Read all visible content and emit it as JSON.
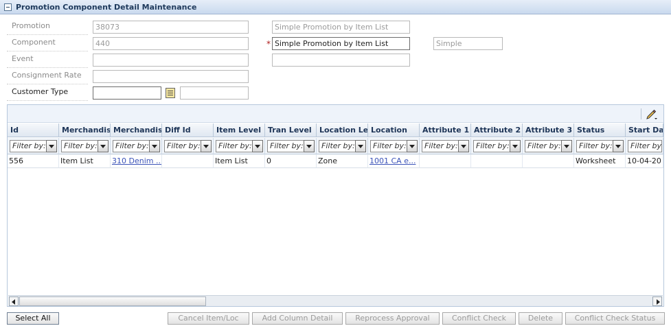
{
  "panel": {
    "title": "Promotion Component Detail Maintenance"
  },
  "form": {
    "promotion": {
      "label": "Promotion",
      "value": "38073",
      "description": "Simple Promotion by Item List"
    },
    "component": {
      "label": "Component",
      "value": "440",
      "name": "Simple Promotion by Item List",
      "type": "Simple"
    },
    "event": {
      "label": "Event",
      "value": "",
      "description": ""
    },
    "consignment_rate": {
      "label": "Consignment Rate",
      "value": ""
    },
    "customer_type": {
      "label": "Customer Type",
      "value": "",
      "description": ""
    }
  },
  "grid": {
    "columns": [
      "Id",
      "Merchandise L",
      "Merchandise I",
      "Diff Id",
      "Item Level",
      "Tran Level",
      "Location Leve",
      "Location",
      "Attribute 1",
      "Attribute 2",
      "Attribute 3",
      "Status",
      "Start Date"
    ],
    "filter_placeholder": "Filter by:",
    "rows": [
      [
        "556",
        "Item List",
        "310 Denim ...",
        "",
        "Item List",
        "0",
        "Zone",
        "1001 CA e...",
        "",
        "",
        "",
        "Worksheet",
        "10-04-20"
      ]
    ]
  },
  "buttons": {
    "select_all": "Select All",
    "cancel_item_loc": "Cancel Item/Loc",
    "add_column_detail": "Add Column Detail",
    "reprocess_approval": "Reprocess Approval",
    "conflict_check": "Conflict Check",
    "delete": "Delete",
    "conflict_check_status": "Conflict Check Status"
  }
}
